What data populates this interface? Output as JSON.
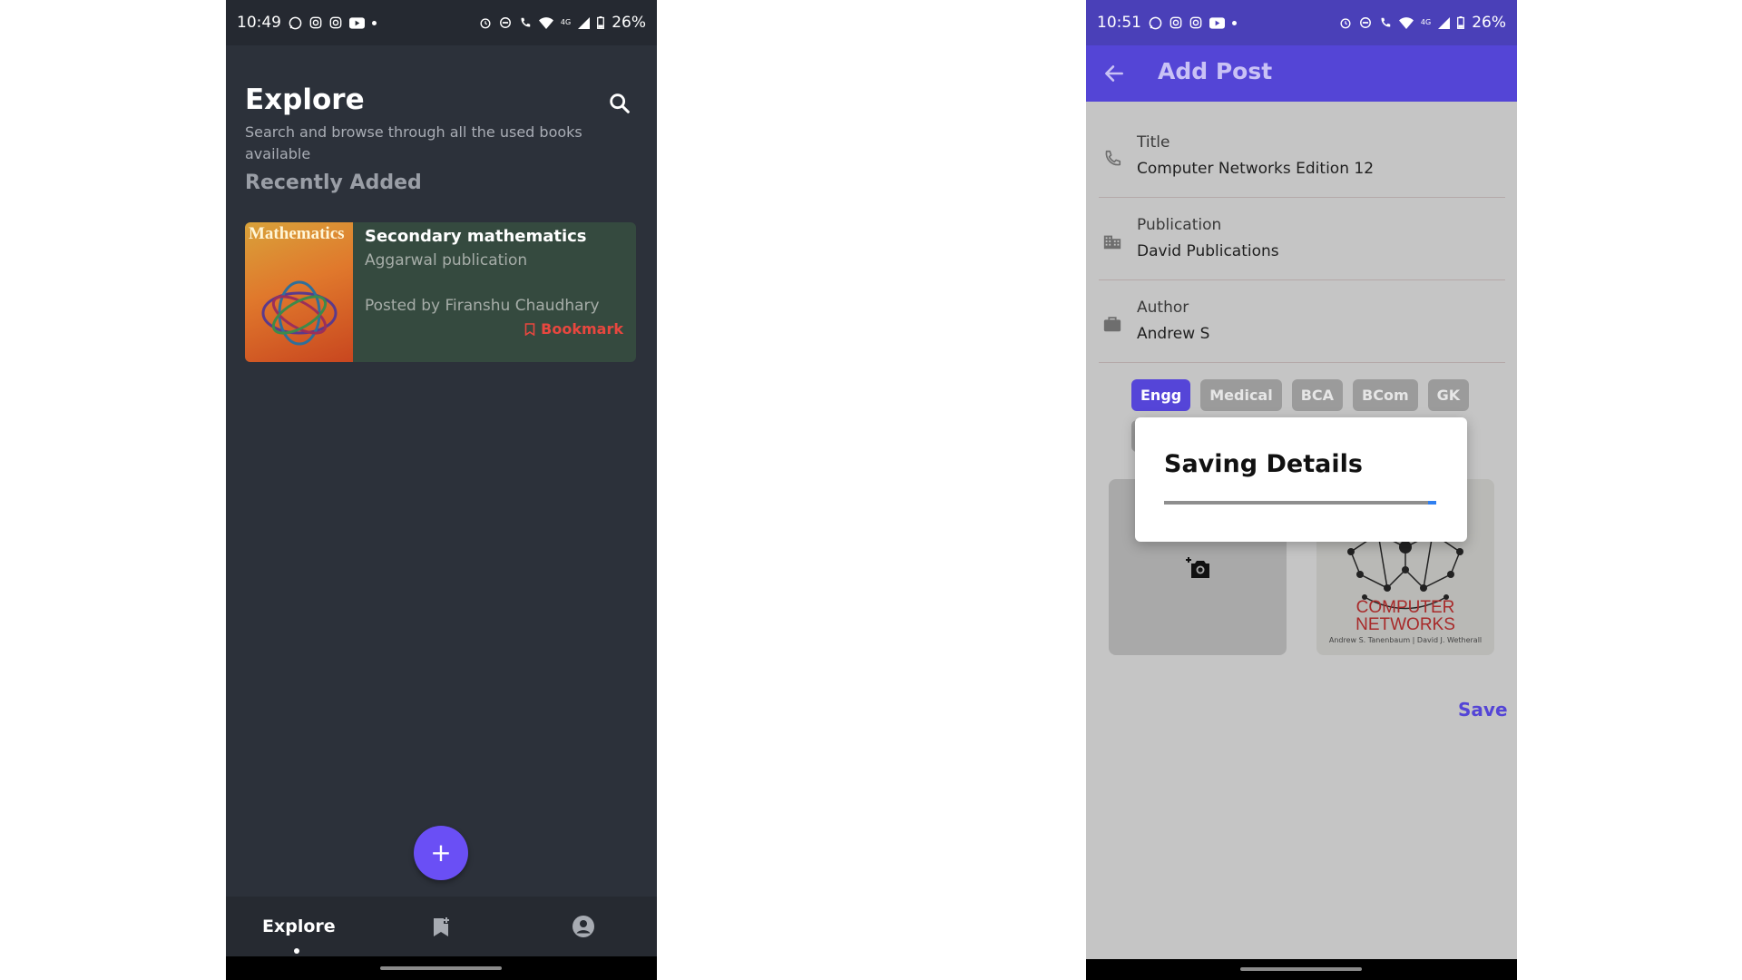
{
  "explore_screen": {
    "status_bar": {
      "time": "10:49",
      "battery": "26%",
      "network": "4G",
      "left_icons": [
        "whatsapp-icon",
        "instagram-icon",
        "instagram-icon",
        "youtube-icon",
        "dot"
      ],
      "right_icons": [
        "alarm-icon",
        "dnd-icon",
        "call-icon",
        "wifi-icon",
        "signal-icon",
        "battery-icon"
      ]
    },
    "title": "Explore",
    "subtitle": "Search and browse through all the used books available",
    "section_title": "Recently Added",
    "books": [
      {
        "title": "Secondary mathematics",
        "publisher": "Aggarwal publication",
        "posted_by": "Posted by Firanshu Chaudhary",
        "bookmark_label": "Bookmark",
        "cover_text": "Mathematics"
      }
    ],
    "fab_symbol": "+",
    "bottom_nav": {
      "explore_label": "Explore",
      "bookmarks_icon": "bookmark-add-icon",
      "account_icon": "account-circle-icon"
    },
    "colors": {
      "background": "#2c313a",
      "card": "#354a3f",
      "accent": "#6a4ff5",
      "bookmark": "#e8473f"
    }
  },
  "add_post_screen": {
    "status_bar": {
      "time": "10:51",
      "battery": "26%",
      "network": "4G",
      "left_icons": [
        "whatsapp-icon",
        "instagram-icon",
        "instagram-icon",
        "youtube-icon",
        "dot"
      ],
      "right_icons": [
        "alarm-icon",
        "dnd-icon",
        "call-icon",
        "wifi-icon",
        "signal-icon",
        "battery-icon"
      ]
    },
    "title": "Add Post",
    "fields": [
      {
        "label": "Title",
        "value": "Computer Networks Edition 12",
        "icon": "phone-icon"
      },
      {
        "label": "Publication",
        "value": "David Publications",
        "icon": "business-icon"
      },
      {
        "label": "Author",
        "value": "Andrew S",
        "icon": "briefcase-icon"
      }
    ],
    "categories": [
      "Engg",
      "Medical",
      "BCA",
      "BCom",
      "GK"
    ],
    "selected_category": "Engg",
    "book_image": {
      "title_line1": "COMPUTER",
      "title_line2": "NETWORKS",
      "authors": "Andrew S. Tanenbaum | David J. Wetherall"
    },
    "save_label": "Save",
    "dialog": {
      "title": "Saving Details",
      "progress": 0.97
    },
    "colors": {
      "app_bar": "#5445d6",
      "background": "#c5c5c5",
      "chip_active": "#5545d8",
      "chip_inactive": "#9b9b9b",
      "progress": "#2f7ff0"
    }
  }
}
